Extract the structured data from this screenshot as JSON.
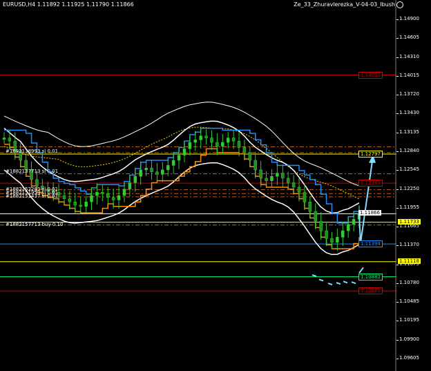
{
  "header": {
    "symbol_ohlc": "EURUSD,H4  1.11892 1.11925 1.11790 1.11866",
    "indicator_name": "Ze_33_Zhuravlerezka_V-04-03_Ibush"
  },
  "colors": {
    "background": "#000000",
    "candle_up": "#32cd32",
    "candle_down": "#228b22",
    "price_blue": "#1e90ff",
    "envelope_white": "#ffffff",
    "band_orange": "#ff8c00",
    "ma_yellow_dotted": "#ffd700",
    "level_red": "#d00000",
    "level_yellow": "#ffff00",
    "level_green": "#00ff7f",
    "arrow_cyan": "#7fdfff"
  },
  "price_axis": {
    "ticks": [
      "1.14900",
      "1.14605",
      "1.14310",
      "1.14015",
      "1.13720",
      "1.13430",
      "1.13135",
      "1.12840",
      "1.12545",
      "1.12250",
      "1.11955",
      "1.11665",
      "1.11370",
      "1.11075",
      "1.10780",
      "1.10485",
      "1.10195",
      "1.09900",
      "1.09605"
    ]
  },
  "levels": [
    {
      "price": "1.14030",
      "color": "red",
      "style": "solid"
    },
    {
      "price": "1.12797",
      "color": "yellow",
      "style": "solid"
    },
    {
      "price": "1.12343",
      "color": "red",
      "style": "solid"
    },
    {
      "price": "1.11866",
      "color": "white",
      "style": "solid"
    },
    {
      "price": "1.11733",
      "color": "yellow",
      "style": "solid"
    },
    {
      "price": "1.11394",
      "color": "blue",
      "style": "solid"
    },
    {
      "price": "1.11118",
      "color": "yellow",
      "style": "solid"
    },
    {
      "price": "1.10882",
      "color": "green",
      "style": "solid"
    },
    {
      "price": "1.10661",
      "color": "red",
      "style": "solid"
    }
  ],
  "order_labels": [
    {
      "text": "#1882138993 sl 0.01",
      "price": 1.1283
    },
    {
      "text": "#1882137713 sl 0.01",
      "price": 1.1252
    },
    {
      "text": "#1882152283 sl 0.01",
      "price": 1.1224
    },
    {
      "text": "#1882151953 sl 0.01",
      "price": 1.1218
    },
    {
      "text": "#1882151437 sl 0.01",
      "price": 1.1213
    },
    {
      "text": "#1882157713 buy 0.10",
      "price": 1.1169
    }
  ],
  "dashed_levels": [
    1.1291,
    1.1282,
    1.1249,
    1.1224,
    1.1218,
    1.1213,
    1.1169
  ],
  "chart_data": {
    "type": "candlestick",
    "symbol": "EURUSD",
    "timeframe": "H4",
    "last": {
      "open": 1.11892,
      "high": 1.11925,
      "low": 1.1179,
      "close": 1.11866
    },
    "ylim": [
      1.095,
      1.1515
    ],
    "close_path": [
      1.1305,
      1.13,
      1.1285,
      1.127,
      1.1255,
      1.124,
      1.123,
      1.1225,
      1.1222,
      1.122,
      1.1215,
      1.121,
      1.1205,
      1.12,
      1.1198,
      1.1205,
      1.1215,
      1.122,
      1.1218,
      1.1212,
      1.1208,
      1.1215,
      1.1225,
      1.1235,
      1.1245,
      1.1255,
      1.1258,
      1.1252,
      1.1248,
      1.1255,
      1.1262,
      1.127,
      1.1278,
      1.1288,
      1.1298,
      1.1302,
      1.1308,
      1.1305,
      1.1298,
      1.1292,
      1.1298,
      1.1305,
      1.13,
      1.129,
      1.1282,
      1.127,
      1.1255,
      1.1242,
      1.1238,
      1.1245,
      1.125,
      1.1242,
      1.1235,
      1.1228,
      1.122,
      1.1205,
      1.119,
      1.1175,
      1.116,
      1.1148,
      1.1142,
      1.115,
      1.116,
      1.117,
      1.1178,
      1.1186
    ]
  }
}
